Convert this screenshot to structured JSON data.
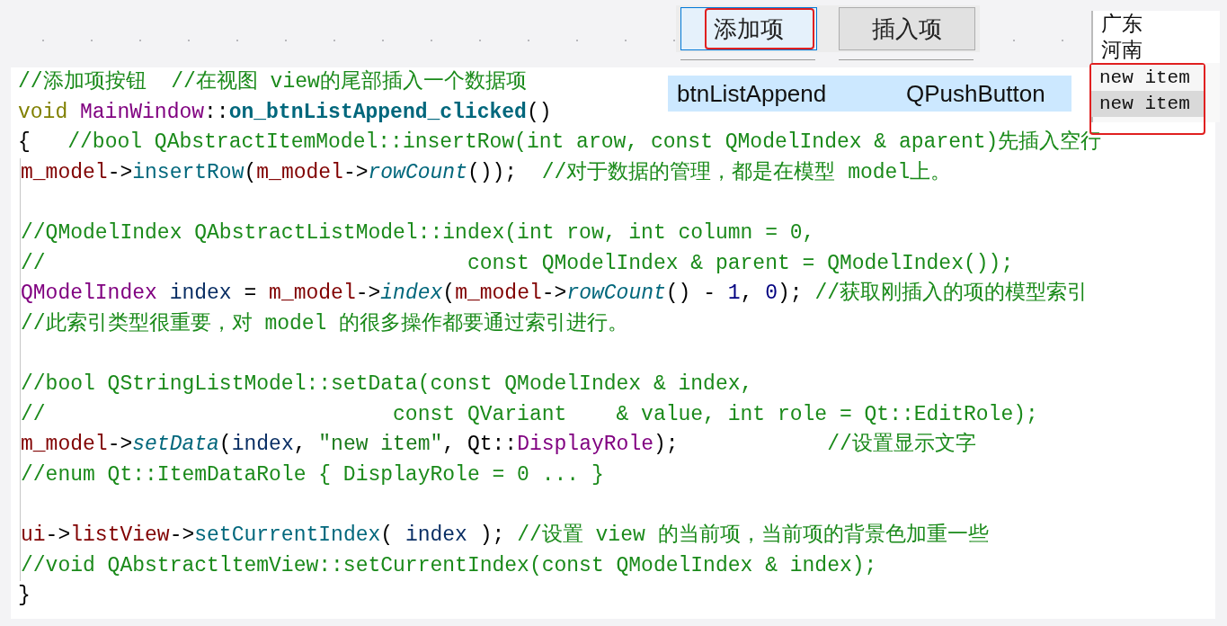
{
  "buttons": [
    {
      "label": "添加项",
      "selected": true,
      "marked": true
    },
    {
      "label": "插入项",
      "selected": false,
      "marked": false
    }
  ],
  "property_row": {
    "name": "btnListAppend",
    "class": "QPushButton"
  },
  "list_view": {
    "items": [
      {
        "text": "广东",
        "selected": false,
        "marked": false
      },
      {
        "text": "河南",
        "selected": false,
        "marked": false
      },
      {
        "text": "new item",
        "selected": false,
        "marked": true
      },
      {
        "text": "new item",
        "selected": true,
        "marked": true
      }
    ]
  },
  "code": {
    "header_lines": [
      {
        "kind": "code",
        "parts": [
          {
            "kind": "comment",
            "text": "//添加项按钮  //在视图 view的尾部插入一个数据项"
          }
        ]
      },
      {
        "kind": "code",
        "parts": [
          {
            "kind": "keyword",
            "text": "void "
          },
          {
            "kind": "type",
            "text": "MainWindow"
          },
          {
            "kind": "plain",
            "text": "::"
          },
          {
            "kind": "function",
            "text": "on_btnListAppend_clicked"
          },
          {
            "kind": "plain",
            "text": "()"
          }
        ]
      },
      {
        "kind": "code",
        "parts": [
          {
            "kind": "plain",
            "text": "{   "
          },
          {
            "kind": "comment",
            "text": "//bool QAbstractItemModel::insertRow(int arow, const QModelIndex & aparent)先插入空行"
          }
        ]
      }
    ],
    "body_lines": [
      {
        "kind": "code",
        "parts": [
          {
            "kind": "member",
            "text": "m_model"
          },
          {
            "kind": "plain",
            "text": "->"
          },
          {
            "kind": "method",
            "text": "insertRow"
          },
          {
            "kind": "plain",
            "text": "("
          },
          {
            "kind": "member",
            "text": "m_model"
          },
          {
            "kind": "plain",
            "text": "->"
          },
          {
            "kind": "virtual",
            "text": "rowCount"
          },
          {
            "kind": "plain",
            "text": "());  "
          },
          {
            "kind": "comment",
            "text": "//对于数据的管理，都是在模型 model上。"
          }
        ]
      },
      {
        "kind": "blank"
      },
      {
        "kind": "code",
        "parts": [
          {
            "kind": "comment",
            "text": "//QModelIndex QAbstractListModel::index(int row, int column = 0,"
          }
        ]
      },
      {
        "kind": "code",
        "parts": [
          {
            "kind": "comment",
            "text": "//                                  const QModelIndex & parent = QModelIndex());"
          }
        ]
      },
      {
        "kind": "code",
        "parts": [
          {
            "kind": "type",
            "text": "QModelIndex "
          },
          {
            "kind": "local",
            "text": "index"
          },
          {
            "kind": "plain",
            "text": " = "
          },
          {
            "kind": "member",
            "text": "m_model"
          },
          {
            "kind": "plain",
            "text": "->"
          },
          {
            "kind": "virtual",
            "text": "index"
          },
          {
            "kind": "plain",
            "text": "("
          },
          {
            "kind": "member",
            "text": "m_model"
          },
          {
            "kind": "plain",
            "text": "->"
          },
          {
            "kind": "virtual",
            "text": "rowCount"
          },
          {
            "kind": "plain",
            "text": "() - "
          },
          {
            "kind": "number",
            "text": "1"
          },
          {
            "kind": "plain",
            "text": ", "
          },
          {
            "kind": "number",
            "text": "0"
          },
          {
            "kind": "plain",
            "text": "); "
          },
          {
            "kind": "comment",
            "text": "//获取刚插入的项的模型索引"
          }
        ]
      },
      {
        "kind": "code",
        "parts": [
          {
            "kind": "comment",
            "text": "//此索引类型很重要，对 model 的很多操作都要通过索引进行。"
          }
        ]
      },
      {
        "kind": "blank"
      },
      {
        "kind": "code",
        "parts": [
          {
            "kind": "comment",
            "text": "//bool QStringListModel::setData(const QModelIndex & index,"
          }
        ]
      },
      {
        "kind": "code",
        "parts": [
          {
            "kind": "comment",
            "text": "//                            const QVariant    & value, int role = Qt::EditRole);"
          }
        ]
      },
      {
        "kind": "code",
        "parts": [
          {
            "kind": "member",
            "text": "m_model"
          },
          {
            "kind": "plain",
            "text": "->"
          },
          {
            "kind": "virtual",
            "text": "setData"
          },
          {
            "kind": "plain",
            "text": "("
          },
          {
            "kind": "local",
            "text": "index"
          },
          {
            "kind": "plain",
            "text": ", "
          },
          {
            "kind": "string",
            "text": "\"new item\""
          },
          {
            "kind": "plain",
            "text": ", Qt::"
          },
          {
            "kind": "type",
            "text": "DisplayRole"
          },
          {
            "kind": "plain",
            "text": ");            "
          },
          {
            "kind": "comment",
            "text": "//设置显示文字"
          }
        ]
      },
      {
        "kind": "code",
        "parts": [
          {
            "kind": "comment",
            "text": "//enum Qt::ItemDataRole { DisplayRole = 0 ... }"
          }
        ]
      },
      {
        "kind": "blank"
      },
      {
        "kind": "code",
        "parts": [
          {
            "kind": "member",
            "text": "ui"
          },
          {
            "kind": "plain",
            "text": "->"
          },
          {
            "kind": "member",
            "text": "listView"
          },
          {
            "kind": "plain",
            "text": "->"
          },
          {
            "kind": "method",
            "text": "setCurrentIndex"
          },
          {
            "kind": "plain",
            "text": "( "
          },
          {
            "kind": "local",
            "text": "index"
          },
          {
            "kind": "plain",
            "text": " ); "
          },
          {
            "kind": "comment",
            "text": "//设置 view 的当前项，当前项的背景色加重一些"
          }
        ]
      },
      {
        "kind": "code",
        "parts": [
          {
            "kind": "comment",
            "text": "//void QAbstractltemView::setCurrentIndex(const QModelIndex & index);"
          }
        ]
      }
    ],
    "closing_line": {
      "kind": "code",
      "parts": [
        {
          "kind": "plain",
          "text": "}"
        }
      ]
    }
  }
}
